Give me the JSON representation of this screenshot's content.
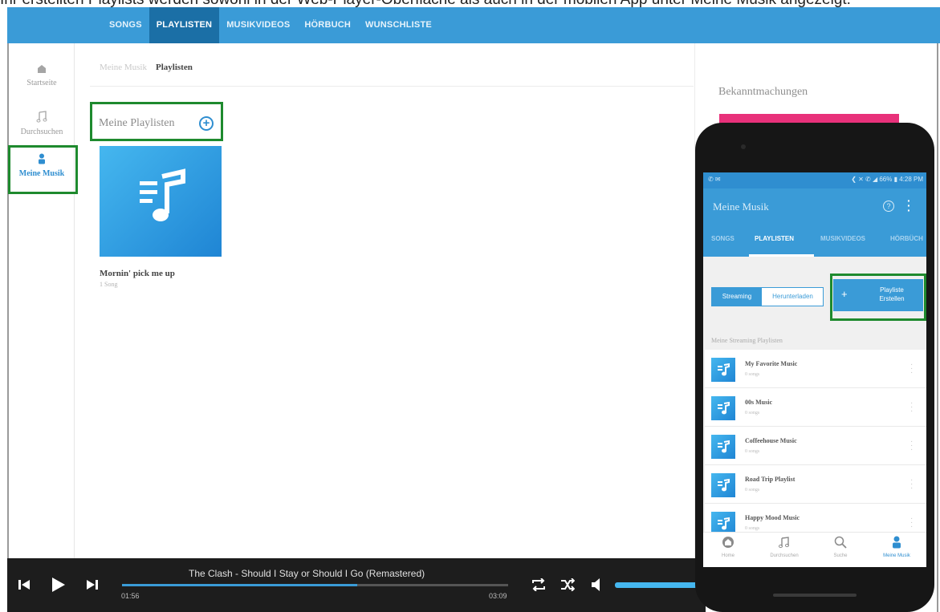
{
  "caption": "Ihr erstellten Playlists werden sowohl in der Web-Player-Oberfläche als auch in der mobilen App unter Meine Musik angezeigt.",
  "topbar": {
    "tabs": [
      {
        "label": "SONGS",
        "active": false
      },
      {
        "label": "PLAYLISTEN",
        "active": true
      },
      {
        "label": "MUSIKVIDEOS",
        "active": false
      },
      {
        "label": "HÖRBUCH",
        "active": false
      },
      {
        "label": "WUNSCHLISTE",
        "active": false
      }
    ]
  },
  "sidenav": {
    "items": [
      {
        "label": "Startseite",
        "icon": "home-icon"
      },
      {
        "label": "Durchsuchen",
        "icon": "music-note-icon"
      },
      {
        "label": "Meine Musik",
        "icon": "user-icon",
        "active": true
      }
    ]
  },
  "breadcrumb": {
    "parent": "Meine Musik",
    "current": "Playlisten"
  },
  "section": {
    "title": "Meine Playlisten"
  },
  "playlist_tile": {
    "title": "Mornin' pick me up",
    "subtitle": "1 Song"
  },
  "announcements": {
    "title": "Bekanntmachungen"
  },
  "player": {
    "track": "The Clash - Should I Stay or Should I Go (Remastered)",
    "elapsed": "01:56",
    "duration": "03:09",
    "progress": 0.61
  },
  "phone": {
    "status_left": "✆ ✉",
    "status_right": "❮ ✕ ✆ ◢ 66% ▮ 4:28 PM",
    "app_title": "Meine Musik",
    "tabs": [
      {
        "label": "SONGS",
        "active": false
      },
      {
        "label": "PLAYLISTEN",
        "active": true
      },
      {
        "label": "MUSIKVIDEOS",
        "active": false
      },
      {
        "label": "HÖRBÜCH",
        "active": false
      }
    ],
    "segment": {
      "streaming": "Streaming",
      "download": "Herunterladen"
    },
    "create_button": {
      "plus": "+",
      "line1": "Playliste",
      "line2": "Erstellen"
    },
    "section_label": "Meine Streaming Playlisten",
    "playlists": [
      {
        "name": "My Favorite Music",
        "count": "0 songs"
      },
      {
        "name": "00s Music",
        "count": "0 songs"
      },
      {
        "name": "Coffeehouse Music",
        "count": "0 songs"
      },
      {
        "name": "Road Trip Playlist",
        "count": "0 songs"
      },
      {
        "name": "Happy Mood Music",
        "count": "0 songs"
      }
    ],
    "bottom_nav": [
      {
        "label": "Home",
        "icon": "home-icon"
      },
      {
        "label": "Durchsuchen",
        "icon": "music-note-icon"
      },
      {
        "label": "Suche",
        "icon": "search-icon"
      },
      {
        "label": "Meine Musik",
        "icon": "user-icon",
        "active": true
      }
    ]
  },
  "colors": {
    "accent": "#3a9bd7",
    "active_tab": "#1b6fa6",
    "highlight": "#1e8a2e",
    "player_bg": "#1d1d1d",
    "announcement_banner": "#e8317a"
  }
}
